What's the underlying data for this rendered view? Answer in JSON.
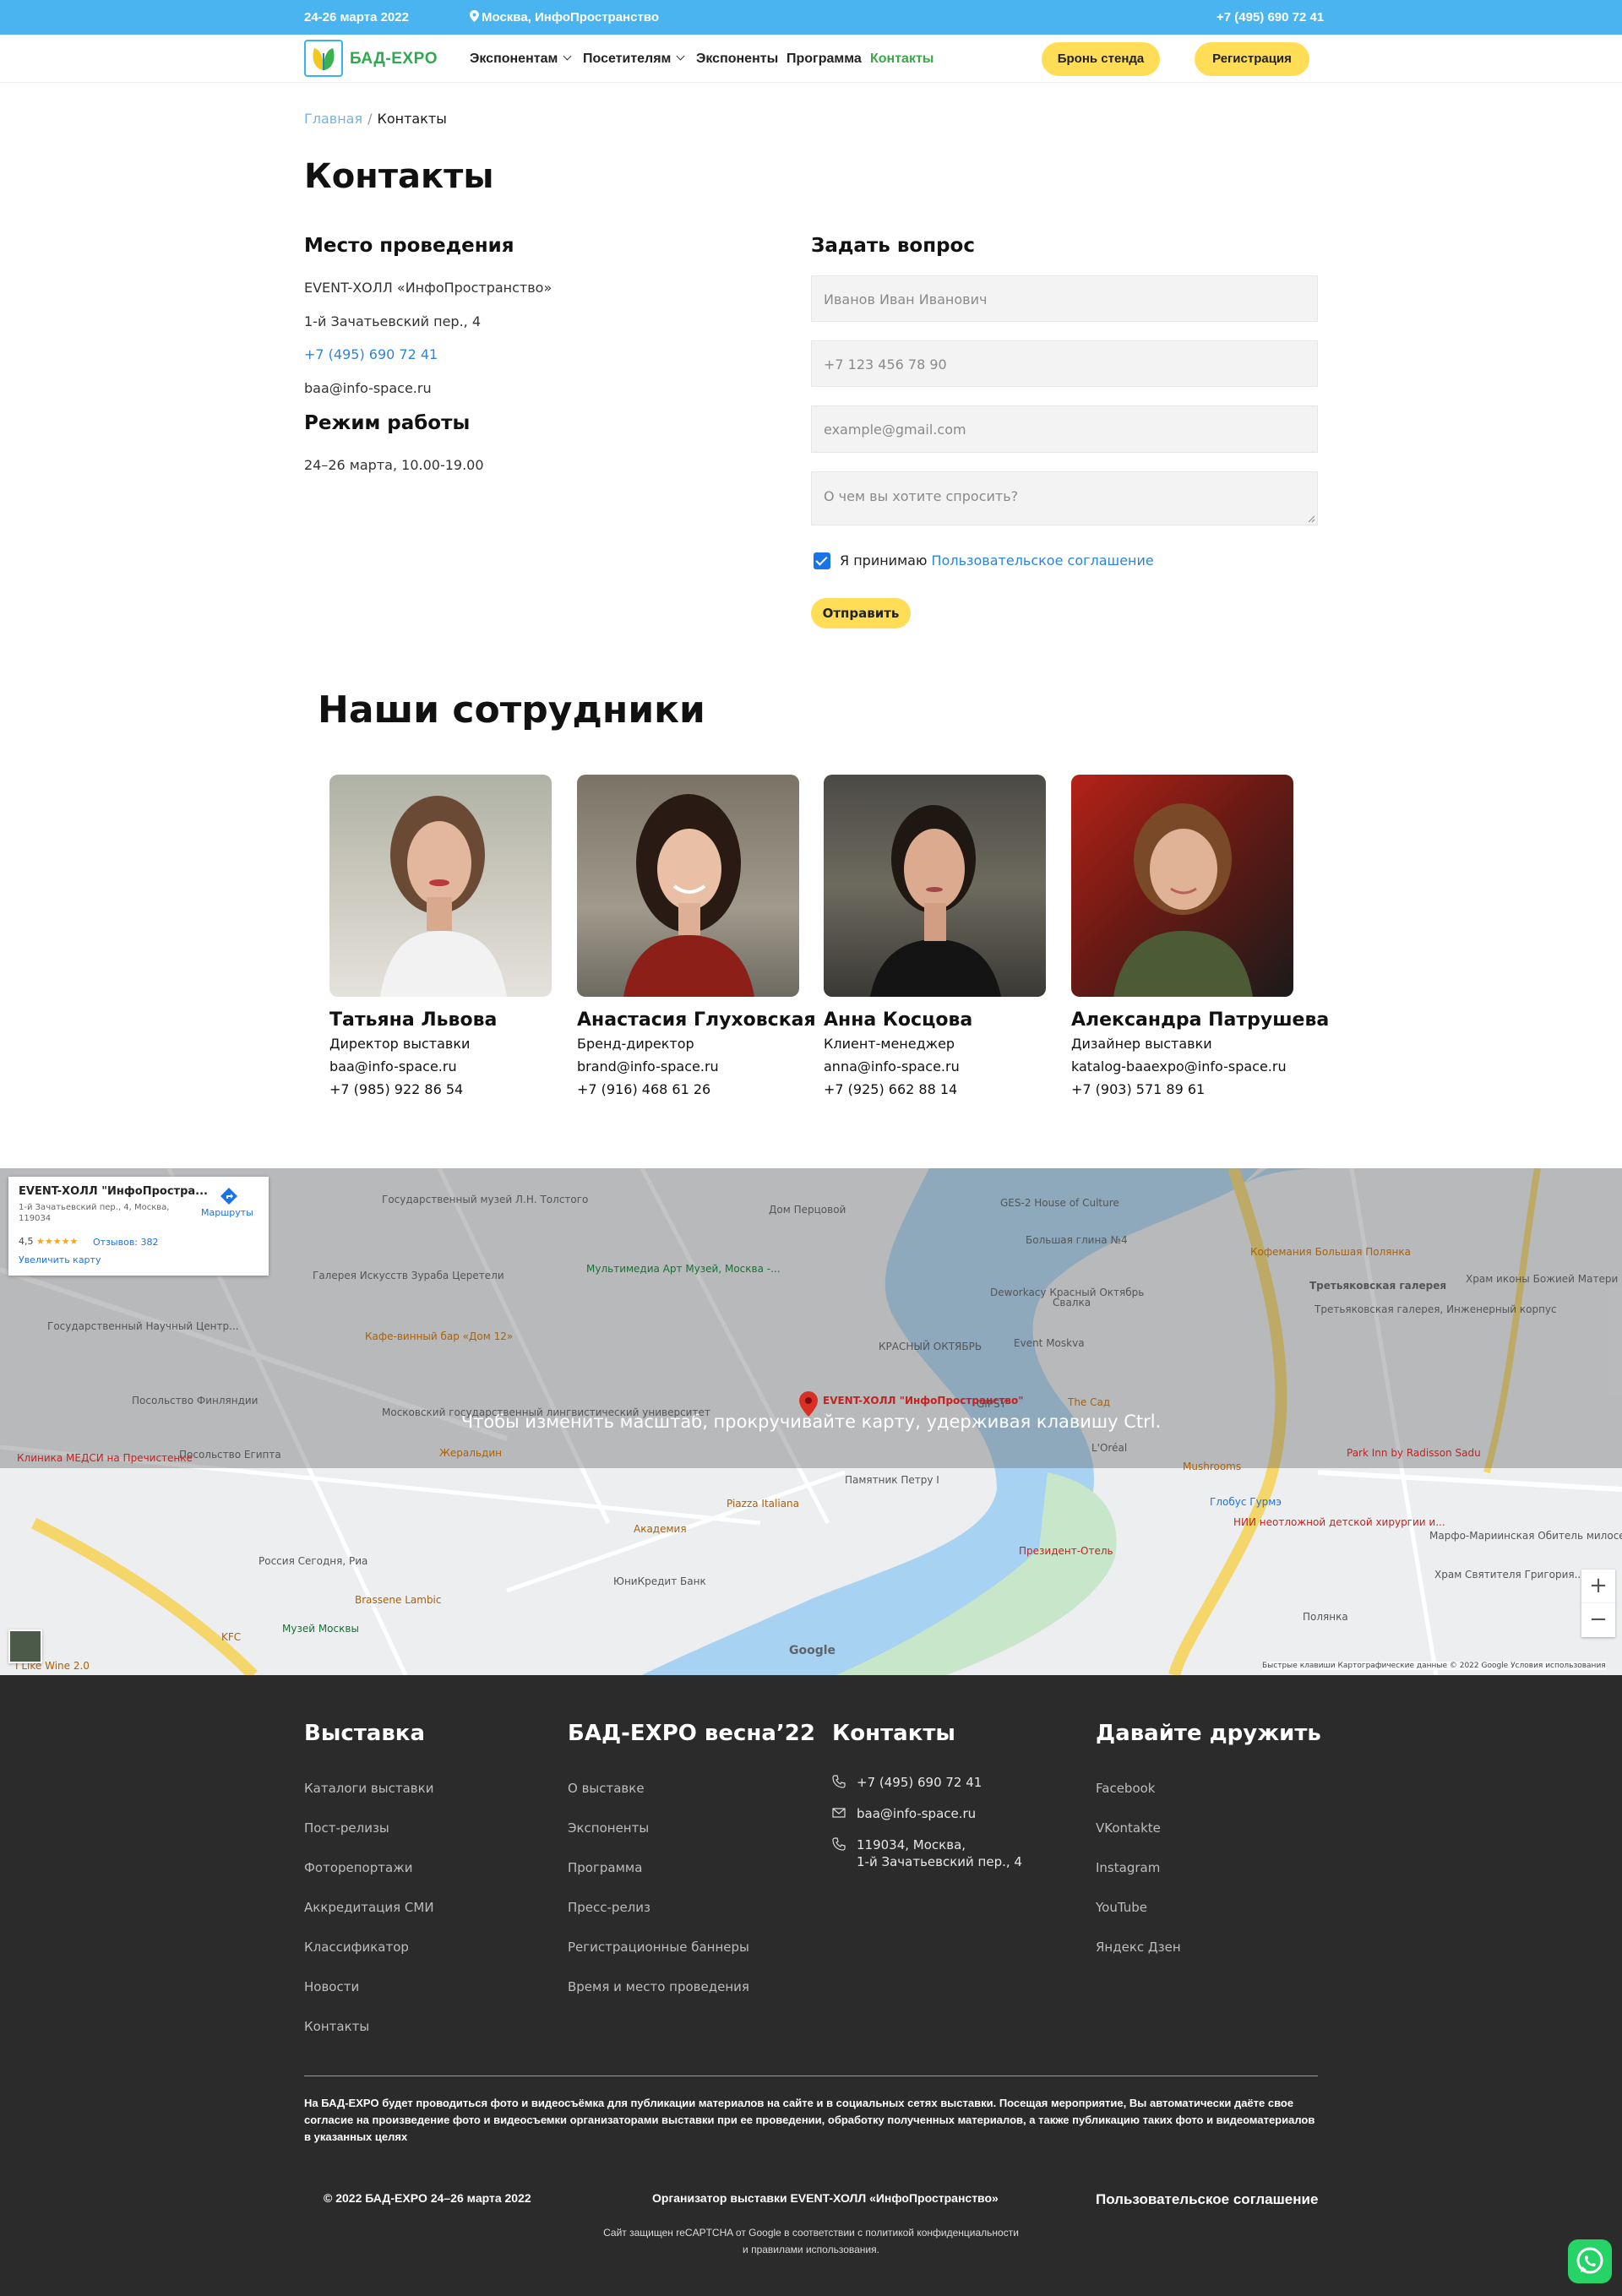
{
  "topbar": {
    "dates": "24-26 марта 2022",
    "location": "Москва, ИнфоПространство",
    "phone": "+7 (495) 690 72 41"
  },
  "nav": {
    "logo_text": "БАД-EXPO",
    "items": [
      {
        "label": "Экспонентам",
        "dropdown": true
      },
      {
        "label": "Посетителям",
        "dropdown": true
      },
      {
        "label": "Экспоненты"
      },
      {
        "label": "Программа"
      },
      {
        "label": "Контакты",
        "active": true
      }
    ],
    "buttons": [
      "Бронь стенда",
      "Регистрация"
    ]
  },
  "breadcrumb": {
    "home": "Главная",
    "separator": "/",
    "current": "Контакты"
  },
  "page_title": "Контакты",
  "venue": {
    "heading": "Место проведения",
    "name": "EVENT-ХОЛЛ «ИнфоПространство»",
    "address": "1-й Зачатьевский пер., 4",
    "phone": "+7 (495) 690 72 41",
    "email": "baa@info-space.ru"
  },
  "hours": {
    "heading": "Режим работы",
    "text": "24–26 марта, 10.00-19.00"
  },
  "form": {
    "heading": "Задать вопрос",
    "name_placeholder": "Иванов Иван Иванович",
    "phone_placeholder": "+7 123 456 78 90",
    "email_placeholder": "example@gmail.com",
    "message_placeholder": "О чем вы хотите спросить?",
    "agree_text": "Я принимаю",
    "agree_link": "Пользовательское соглашение",
    "agree_checked": true,
    "submit_label": "Отправить"
  },
  "staff": {
    "heading": "Наши сотрудники",
    "members": [
      {
        "name": "Татьяна Львова",
        "role": "Директор выставки",
        "email": "baa@info-space.ru",
        "phone": "+7 (985) 922 86 54"
      },
      {
        "name": "Анастасия Глуховская",
        "role": "Бренд-директор",
        "email": "brand@info-space.ru",
        "phone": "+7 (916) 468 61 26"
      },
      {
        "name": "Анна Косцова",
        "role": "Клиент-менеджер",
        "email": "anna@info-space.ru",
        "phone": "+7 (925) 662 88 14"
      },
      {
        "name": "Александра Патрушева",
        "role": "Дизайнер выставки",
        "email": "katalog-baaexpo@info-space.ru",
        "phone": "+7 (903) 571 89 61"
      }
    ]
  },
  "map": {
    "overlay_message": "Чтобы изменить масштаб, прокручивайте карту, удерживая клавишу Ctrl.",
    "card_title": "EVENT-ХОЛЛ \"ИнфоПростра...",
    "card_address": "1-й Зачатьевский пер., 4, Москва, 119034",
    "card_rating": "4,5",
    "card_stars": "★★★★★",
    "card_reviews": "Отзывов: 382",
    "card_directions": "Маршруты",
    "card_enlarge": "Увеличить карту",
    "marker_label": "EVENT-ХОЛЛ \"ИнфоПространство\"",
    "labels": [
      "Дом Перцовой",
      "GES-2 House of Culture",
      "Большая глина №4",
      "Кофемания Большая Полянка",
      "Третьяковская галерея",
      "Храм иконы Божией Матери \"Всех...",
      "Третьяковская галерея, Инженерный корпус",
      "Мультимедиа Арт Музей, Москва -...",
      "Галерея Искусств Зураба Церетели",
      "Государственный музей Л.Н. Толстого",
      "Государственный Научный Центр...",
      "Кафе-винный бар «Дом 12»",
      "Deworkacy Красный Октябрь",
      "Свалка",
      "КРАСНЫЙ ОКТЯБРЬ",
      "Event Moskva",
      "GIPSY",
      "The Сад",
      "Посольство Финляндии",
      "Московский государственный лингвистический университет",
      "Посольство Египта",
      "Клиника МЕДСИ на Пречистенке",
      "Жеральдин",
      "Памятник Петру I",
      "Park Inn by Radisson Sadu",
      "Mushrooms",
      "Глобус Гурмэ",
      "НИИ неотложной детской хирургии и...",
      "Марфо-Мариинская Обитель милосердия",
      "Piazza Italiana",
      "Академия",
      "ЮниКредит Банк",
      "Президент-Отель",
      "Россия Сегодня, Риа",
      "Brassene Lambic",
      "Музей Москвы",
      "KFC",
      "I Like Wine 2.0",
      "Храм Святителя Григория...",
      "Полянка",
      "L'Oréal"
    ],
    "zoom_in": "+",
    "zoom_out": "−",
    "footer_text": "Быстрые клавиши   Картографические данные © 2022 Google   Условия использования",
    "google": "Google"
  },
  "footer": {
    "col1": {
      "title": "Выставка",
      "links": [
        "Каталоги выставки",
        "Пост-релизы",
        "Фоторепортажи",
        "Аккредитация СМИ",
        "Классификатор",
        "Новости",
        "Контакты"
      ]
    },
    "col2": {
      "title": "БАД-EXPO весна’22",
      "links": [
        "О выставке",
        "Экспоненты",
        "Программа",
        "Пресс-релиз",
        "Регистрационные баннеры",
        "Время и место проведения"
      ]
    },
    "col3": {
      "title": "Контакты",
      "phone": "+7 (495) 690 72 41",
      "email": "baa@info-space.ru",
      "address_line1": "119034, Москва,",
      "address_line2": "1-й Зачатьевский пер., 4"
    },
    "col4": {
      "title": "Давайте дружить",
      "links": [
        "Facebook",
        "VKontakte",
        "Instagram",
        "YouTube",
        "Яндекс Дзен"
      ]
    },
    "notice": "На БАД-EXPO будет проводиться фото и видеосъёмка для публикации материалов на сайте и в социальных сетях выставки. Посещая мероприятие, Вы автоматически даёте свое согласие на произведение фото и видеосъемки организаторами выставки при ее проведении, обработку полученных материалов, а также публикацию таких фото и видеоматериалов в указанных целях",
    "copyright": "© 2022 БАД-EXPO 24–26 марта 2022",
    "organizer": "Организатор выставки EVENT-ХОЛЛ «ИнфоПространство»",
    "agreement": "Пользовательское соглашение",
    "recaptcha_line1": "Сайт защищен reCAPTCHA от Google в соответствии с политикой конфиденциальности",
    "recaptcha_line2": "и правилами использования."
  },
  "colors": {
    "topbar": "#49b4f0",
    "accent_yellow": "#ffdd57",
    "nav_active": "#3aa74a",
    "link": "#2d84d8",
    "footer_bg": "#2b2b2b",
    "whatsapp": "#25d366"
  }
}
